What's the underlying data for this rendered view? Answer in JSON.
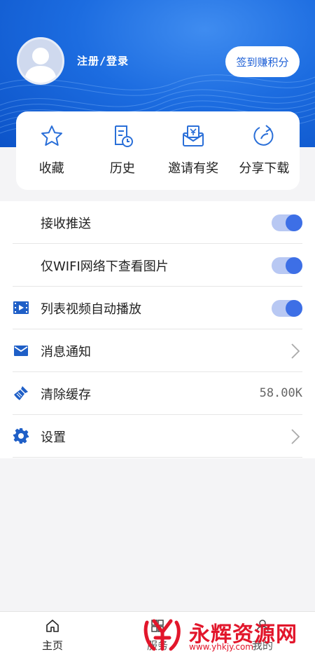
{
  "header": {
    "login_text": "注册/登录",
    "checkin_label": "签到赚积分",
    "colors": {
      "bg": "#1c6ce0",
      "accent": "#1d5fd6"
    }
  },
  "quick_actions": [
    {
      "label": "收藏",
      "icon": "star-icon"
    },
    {
      "label": "历史",
      "icon": "history-icon"
    },
    {
      "label": "邀请有奖",
      "icon": "invite-reward-icon"
    },
    {
      "label": "分享下载",
      "icon": "share-icon"
    }
  ],
  "settings": [
    {
      "label": "接收推送",
      "control": "toggle",
      "on": true
    },
    {
      "label": "仅WIFI网络下查看图片",
      "control": "toggle",
      "on": true
    },
    {
      "label": "列表视频自动播放",
      "control": "toggle",
      "on": true,
      "icon": "video-icon"
    },
    {
      "label": "消息通知",
      "control": "chevron",
      "icon": "mail-icon"
    },
    {
      "label": "清除缓存",
      "control": "value",
      "value": "58.00K",
      "icon": "broom-icon"
    },
    {
      "label": "设置",
      "control": "chevron",
      "icon": "gear-icon"
    }
  ],
  "bottom_nav": [
    {
      "label": "主页",
      "icon": "home-icon"
    },
    {
      "label": "服务",
      "icon": "service-icon"
    },
    {
      "label": "我的",
      "icon": "profile-icon"
    }
  ],
  "watermark": {
    "text": "永辉资源网",
    "url": "www.yhkjy.com"
  }
}
